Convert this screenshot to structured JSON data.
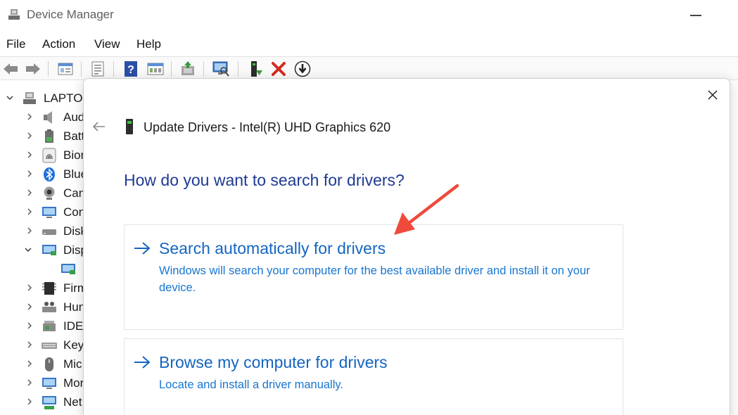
{
  "window": {
    "title": "Device Manager"
  },
  "menu": {
    "items": [
      "File",
      "Action",
      "View",
      "Help"
    ]
  },
  "tree": {
    "root_label": "LAPTOP",
    "items": [
      "Aud",
      "Batt",
      "Bior",
      "Blue",
      "Can",
      "Con",
      "Disk",
      "Disp",
      "",
      "Firm",
      "Hun",
      "IDE",
      "Key",
      "Mic",
      "Mor",
      "Net"
    ]
  },
  "dialog": {
    "title": "Update Drivers - Intel(R) UHD Graphics 620",
    "question": "How do you want to search for drivers?",
    "option_auto": {
      "title": "Search automatically for drivers",
      "description": "Windows will search your computer for the best available driver and install it on your device."
    },
    "option_browse": {
      "title": "Browse my computer for drivers",
      "description": "Locate and install a driver manually."
    }
  },
  "colors": {
    "heading": "#1f3a93",
    "link": "#1565c0",
    "annotation_arrow": "#ef4a3b"
  },
  "icons": {
    "toolbar": [
      "back-arrow-icon",
      "forward-arrow-icon",
      "properties-grid-icon",
      "document-icon",
      "help-icon",
      "view-icon",
      "update-driver-icon",
      "scan-hardware-icon",
      "enable-device-icon",
      "uninstall-icon",
      "download-icon"
    ],
    "dialog": [
      "close-icon",
      "back-arrow-icon",
      "gpu-icon",
      "right-arrow-icon"
    ]
  }
}
